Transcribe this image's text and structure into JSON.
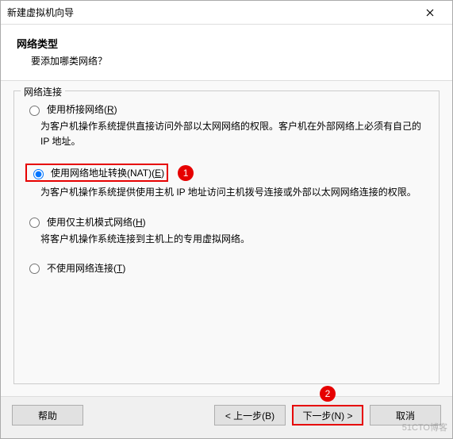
{
  "window": {
    "title": "新建虚拟机向导"
  },
  "header": {
    "title": "网络类型",
    "subtitle": "要添加哪类网络？"
  },
  "group": {
    "label": "网络连接",
    "options": {
      "bridge": {
        "label_pre": "使用桥接网络(",
        "accel": "R",
        "label_post": ")",
        "desc": "为客户机操作系统提供直接访问外部以太网网络的权限。客户机在外部网络上必须有自己的 IP 地址。"
      },
      "nat": {
        "label_pre": "使用网络地址转换(NAT)(",
        "accel": "E",
        "label_post": ")",
        "desc": "为客户机操作系统提供使用主机 IP 地址访问主机拨号连接或外部以太网网络连接的权限。",
        "badge": "1"
      },
      "hostonly": {
        "label_pre": "使用仅主机模式网络(",
        "accel": "H",
        "label_post": ")",
        "desc": "将客户机操作系统连接到主机上的专用虚拟网络。"
      },
      "none": {
        "label_pre": "不使用网络连接(",
        "accel": "T",
        "label_post": ")"
      }
    }
  },
  "footer": {
    "help": "帮助",
    "back": "< 上一步(B)",
    "next": "下一步(N) >",
    "next_badge": "2",
    "cancel": "取消"
  },
  "watermark": "51CTO博客"
}
